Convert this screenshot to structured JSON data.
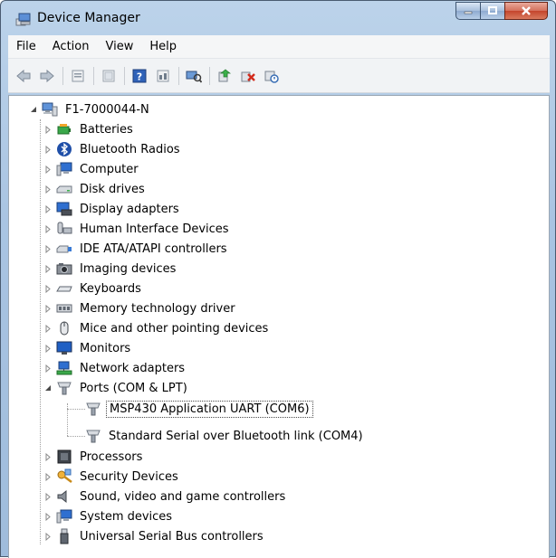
{
  "window": {
    "title": "Device Manager",
    "title_icon": "device-manager-icon"
  },
  "menu": [
    "File",
    "Action",
    "View",
    "Help"
  ],
  "toolbar": {
    "buttons": [
      "back-arrow-icon",
      "forward-arrow-icon",
      "properties-icon",
      "show-hidden-icon",
      "help-icon",
      "view-icon",
      "scan-hardware-icon",
      "update-driver-icon",
      "uninstall-icon",
      "disable-device-icon"
    ]
  },
  "tree": {
    "root": {
      "label": "F1-7000044-N",
      "icon": "computer-icon",
      "expanded": true
    },
    "categories": [
      {
        "label": "Batteries",
        "icon": "battery-icon"
      },
      {
        "label": "Bluetooth Radios",
        "icon": "bluetooth-icon"
      },
      {
        "label": "Computer",
        "icon": "computer-icon"
      },
      {
        "label": "Disk drives",
        "icon": "disk-drive-icon"
      },
      {
        "label": "Display adapters",
        "icon": "display-adapter-icon"
      },
      {
        "label": "Human Interface Devices",
        "icon": "hid-icon"
      },
      {
        "label": "IDE ATA/ATAPI controllers",
        "icon": "ide-controller-icon"
      },
      {
        "label": "Imaging devices",
        "icon": "camera-icon"
      },
      {
        "label": "Keyboards",
        "icon": "keyboard-icon"
      },
      {
        "label": "Memory technology driver",
        "icon": "memory-icon"
      },
      {
        "label": "Mice and other pointing devices",
        "icon": "mouse-icon"
      },
      {
        "label": "Monitors",
        "icon": "monitor-icon"
      },
      {
        "label": "Network adapters",
        "icon": "network-adapter-icon"
      },
      {
        "label": "Ports (COM & LPT)",
        "icon": "port-icon",
        "expanded": true,
        "children": [
          {
            "label": "MSP430 Application UART (COM6)",
            "icon": "port-icon",
            "selected": true
          },
          {
            "label": "Standard Serial over Bluetooth link (COM4)",
            "icon": "port-icon"
          }
        ]
      },
      {
        "label": "Processors",
        "icon": "processor-icon"
      },
      {
        "label": "Security Devices",
        "icon": "security-icon"
      },
      {
        "label": "Sound, video and game controllers",
        "icon": "speaker-icon"
      },
      {
        "label": "System devices",
        "icon": "system-devices-icon"
      },
      {
        "label": "Universal Serial Bus controllers",
        "icon": "usb-icon"
      }
    ]
  }
}
